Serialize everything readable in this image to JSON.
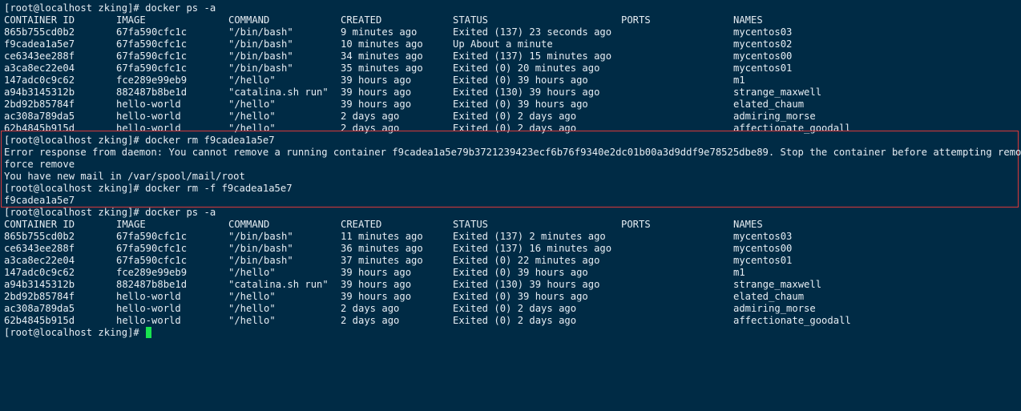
{
  "prompt": "[root@localhost zking]# ",
  "first_command": "docker ps -a",
  "table_headers": {
    "id": "CONTAINER ID",
    "image": "IMAGE",
    "command": "COMMAND",
    "created": "CREATED",
    "status": "STATUS",
    "ports": "PORTS",
    "names": "NAMES"
  },
  "first_list": [
    {
      "id": "865b755cd0b2",
      "image": "67fa590cfc1c",
      "command": "\"/bin/bash\"",
      "created": "9 minutes ago",
      "status": "Exited (137) 23 seconds ago",
      "ports": "",
      "names": "mycentos03"
    },
    {
      "id": "f9cadea1a5e7",
      "image": "67fa590cfc1c",
      "command": "\"/bin/bash\"",
      "created": "10 minutes ago",
      "status": "Up About a minute",
      "ports": "",
      "names": "mycentos02"
    },
    {
      "id": "ce6343ee288f",
      "image": "67fa590cfc1c",
      "command": "\"/bin/bash\"",
      "created": "34 minutes ago",
      "status": "Exited (137) 15 minutes ago",
      "ports": "",
      "names": "mycentos00"
    },
    {
      "id": "a3ca8ec22e04",
      "image": "67fa590cfc1c",
      "command": "\"/bin/bash\"",
      "created": "35 minutes ago",
      "status": "Exited (0) 20 minutes ago",
      "ports": "",
      "names": "mycentos01"
    },
    {
      "id": "147adc0c9c62",
      "image": "fce289e99eb9",
      "command": "\"/hello\"",
      "created": "39 hours ago",
      "status": "Exited (0) 39 hours ago",
      "ports": "",
      "names": "m1"
    },
    {
      "id": "a94b3145312b",
      "image": "882487b8be1d",
      "command": "\"catalina.sh run\"",
      "created": "39 hours ago",
      "status": "Exited (130) 39 hours ago",
      "ports": "",
      "names": "strange_maxwell"
    },
    {
      "id": "2bd92b85784f",
      "image": "hello-world",
      "command": "\"/hello\"",
      "created": "39 hours ago",
      "status": "Exited (0) 39 hours ago",
      "ports": "",
      "names": "elated_chaum"
    },
    {
      "id": "ac308a789da5",
      "image": "hello-world",
      "command": "\"/hello\"",
      "created": "2 days ago",
      "status": "Exited (0) 2 days ago",
      "ports": "",
      "names": "admiring_morse"
    },
    {
      "id": "62b4845b915d",
      "image": "hello-world",
      "command": "\"/hello\"",
      "created": "2 days ago",
      "status": "Exited (0) 2 days ago",
      "ports": "",
      "names": "affectionate_goodall"
    }
  ],
  "rm_command": "docker rm f9cadea1a5e7",
  "error_line_1": "Error response from daemon: You cannot remove a running container f9cadea1a5e79b3721239423ecf6b76f9340e2dc01b00a3d9ddf9e78525dbe89. Stop the container before attempting removal or",
  "error_line_2": "force remove",
  "mail_notice": "You have new mail in /var/spool/mail/root",
  "force_rm_command": "docker rm -f f9cadea1a5e7",
  "force_rm_output": "f9cadea1a5e7",
  "second_command": "docker ps -a",
  "second_list": [
    {
      "id": "865b755cd0b2",
      "image": "67fa590cfc1c",
      "command": "\"/bin/bash\"",
      "created": "11 minutes ago",
      "status": "Exited (137) 2 minutes ago",
      "ports": "",
      "names": "mycentos03"
    },
    {
      "id": "ce6343ee288f",
      "image": "67fa590cfc1c",
      "command": "\"/bin/bash\"",
      "created": "36 minutes ago",
      "status": "Exited (137) 16 minutes ago",
      "ports": "",
      "names": "mycentos00"
    },
    {
      "id": "a3ca8ec22e04",
      "image": "67fa590cfc1c",
      "command": "\"/bin/bash\"",
      "created": "37 minutes ago",
      "status": "Exited (0) 22 minutes ago",
      "ports": "",
      "names": "mycentos01"
    },
    {
      "id": "147adc0c9c62",
      "image": "fce289e99eb9",
      "command": "\"/hello\"",
      "created": "39 hours ago",
      "status": "Exited (0) 39 hours ago",
      "ports": "",
      "names": "m1"
    },
    {
      "id": "a94b3145312b",
      "image": "882487b8be1d",
      "command": "\"catalina.sh run\"",
      "created": "39 hours ago",
      "status": "Exited (130) 39 hours ago",
      "ports": "",
      "names": "strange_maxwell"
    },
    {
      "id": "2bd92b85784f",
      "image": "hello-world",
      "command": "\"/hello\"",
      "created": "39 hours ago",
      "status": "Exited (0) 39 hours ago",
      "ports": "",
      "names": "elated_chaum"
    },
    {
      "id": "ac308a789da5",
      "image": "hello-world",
      "command": "\"/hello\"",
      "created": "2 days ago",
      "status": "Exited (0) 2 days ago",
      "ports": "",
      "names": "admiring_morse"
    },
    {
      "id": "62b4845b915d",
      "image": "hello-world",
      "command": "\"/hello\"",
      "created": "2 days ago",
      "status": "Exited (0) 2 days ago",
      "ports": "",
      "names": "affectionate_goodall"
    }
  ],
  "colors": {
    "background": "#002b45",
    "text": "#e6edf3",
    "highlight_border": "#d9383a",
    "cursor": "#19e34f"
  }
}
